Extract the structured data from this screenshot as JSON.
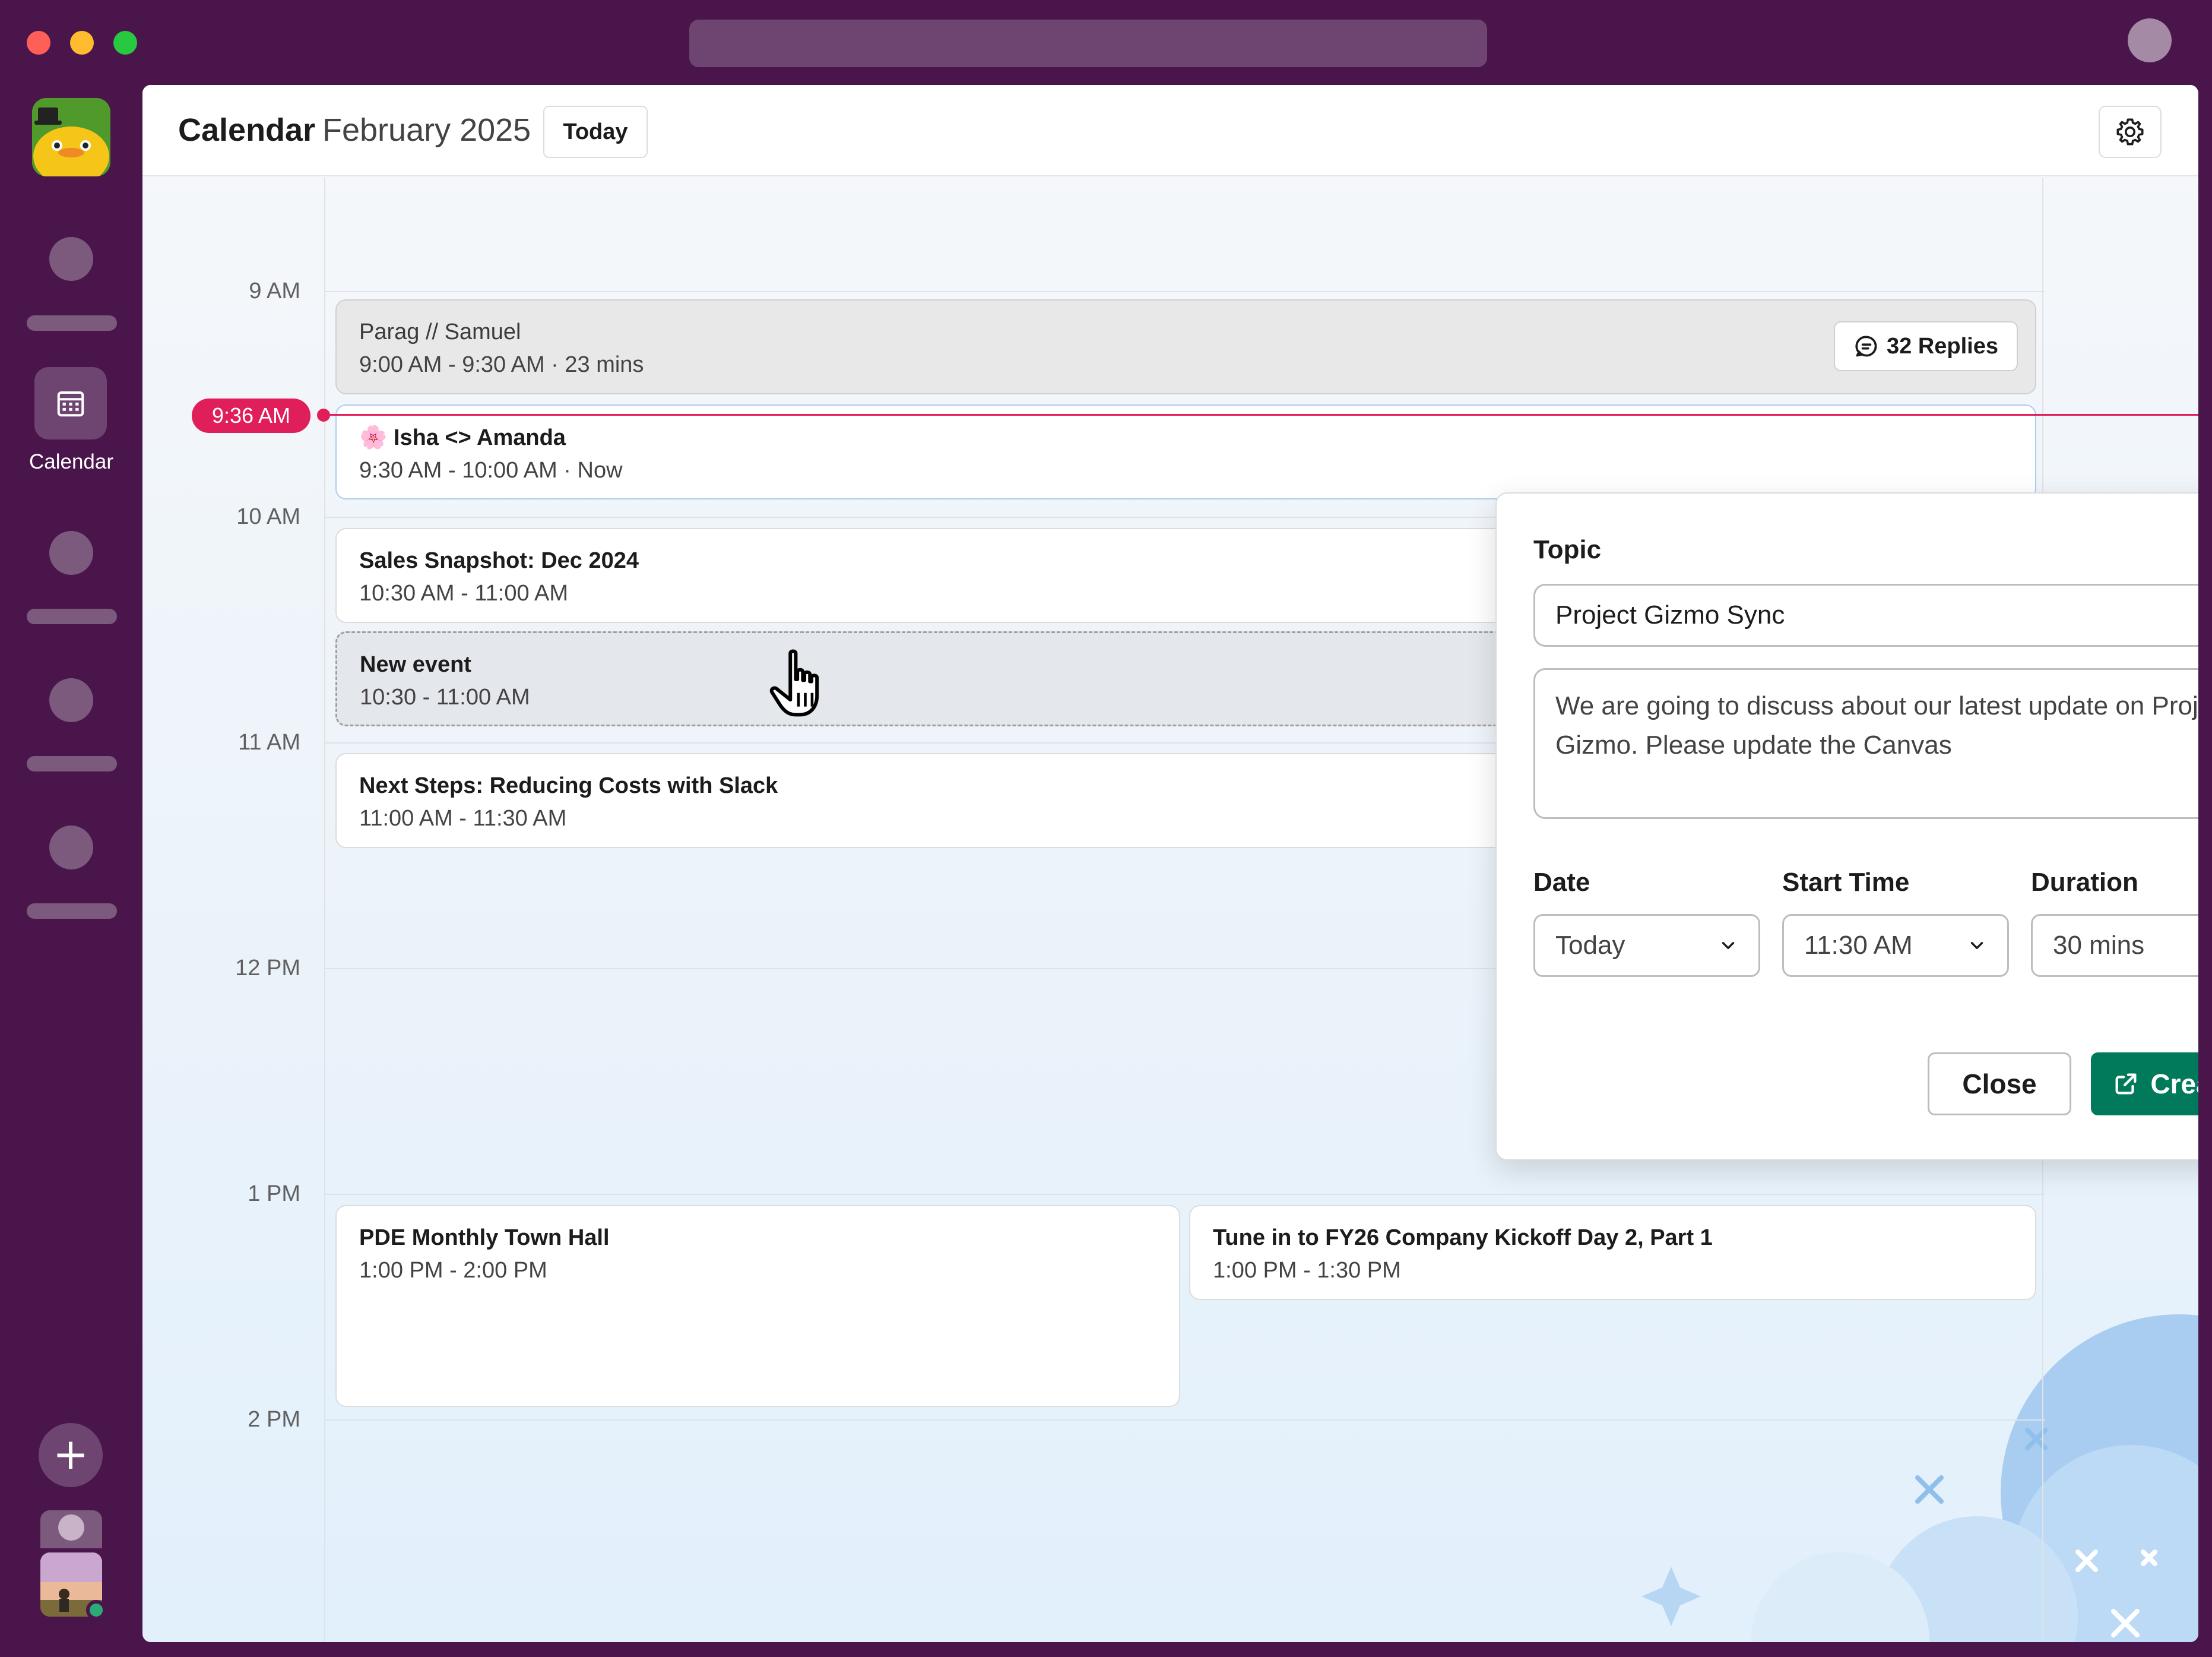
{
  "app": {
    "nav_calendar_label": "Calendar"
  },
  "header": {
    "title": "Calendar",
    "month": "February 2025",
    "today_button": "Today"
  },
  "timeline": {
    "hours": [
      "9 AM",
      "10 AM",
      "11 AM",
      "12 PM",
      "1 PM",
      "2 PM"
    ],
    "current_time": "9:36 AM"
  },
  "events": [
    {
      "title": "Parag // Samuel",
      "time": "9:00 AM - 9:30 AM · 23 mins",
      "replies": "32 Replies"
    },
    {
      "emoji": "🌸",
      "title": "Isha <> Amanda",
      "time": "9:30 AM - 10:00 AM · Now"
    },
    {
      "title": "Sales Snapshot: Dec 2024",
      "time": "10:30 AM - 11:00 AM"
    },
    {
      "title": "New event",
      "time": "10:30  - 11:00 AM"
    },
    {
      "title": "Next Steps: Reducing Costs with Slack",
      "time": "11:00 AM - 11:30 AM"
    },
    {
      "title": "PDE Monthly Town Hall",
      "time": "1:00 PM - 2:00 PM"
    },
    {
      "title": "Tune in to FY26 Company Kickoff Day 2, Part 1",
      "time": "1:00 PM - 1:30 PM"
    }
  ],
  "dialog": {
    "topic_label": "Topic",
    "topic_value": "Project Gizmo Sync",
    "description": "We are going to discuss about our latest update on Project Gizmo. Please update the Canvas",
    "date_label": "Date",
    "date_value": "Today",
    "start_label": "Start Time",
    "start_value": "11:30 AM",
    "duration_label": "Duration",
    "duration_value": "30 mins",
    "close_button": "Close",
    "create_button": "Create"
  },
  "colors": {
    "sidebar": "#4a154b",
    "now_indicator": "#e01e5a",
    "create_button": "#007a5a"
  }
}
